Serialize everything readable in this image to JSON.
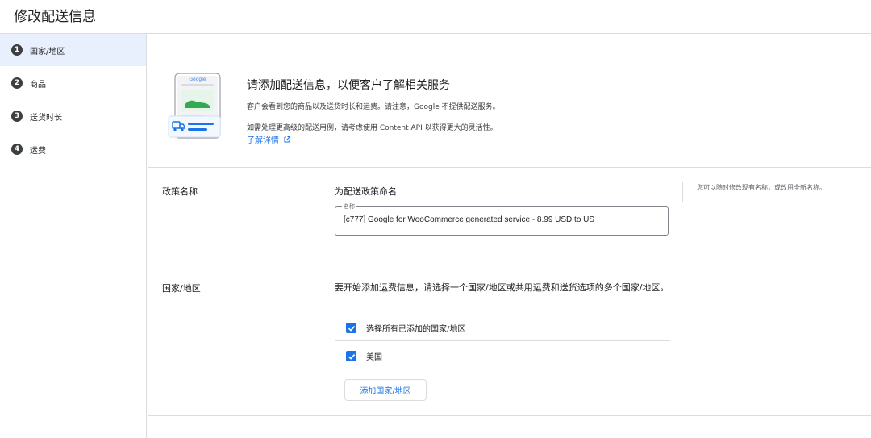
{
  "page": {
    "title": "修改配送信息"
  },
  "sidebar": {
    "steps": [
      {
        "number": "1",
        "label": "国家/地区",
        "active": true
      },
      {
        "number": "2",
        "label": "商品"
      },
      {
        "number": "3",
        "label": "送货时长"
      },
      {
        "number": "4",
        "label": "运费"
      }
    ]
  },
  "intro": {
    "illustration_brand": "Google",
    "title": "请添加配送信息，以便客户了解相关服务",
    "description": "客户会看到您的商品以及送货时长和运费。请注意，Google 不提供配送服务。",
    "description2": "如需处理更高级的配送用例，请考虑使用 Content API 以获得更大的灵活性。",
    "learn_more": "了解详情"
  },
  "policy_name": {
    "section_label": "政策名称",
    "heading": "为配送政策命名",
    "field_label": "名称",
    "field_value": "[c777] Google for WooCommerce generated service - 8.99 USD to US",
    "hint": "您可以随时修改现有名称，或改用全新名称。"
  },
  "country": {
    "section_label": "国家/地区",
    "description": "要开始添加运费信息，请选择一个国家/地区或共用运费和送货选项的多个国家/地区。",
    "select_all_label": "选择所有已添加的国家/地区",
    "select_all_checked": true,
    "countries": [
      {
        "label": "美国",
        "checked": true
      }
    ],
    "add_button": "添加国家/地区"
  },
  "colors": {
    "accent": "#1a73e8",
    "active_step_bg": "#e8f0fe",
    "divider": "#dadce0"
  }
}
